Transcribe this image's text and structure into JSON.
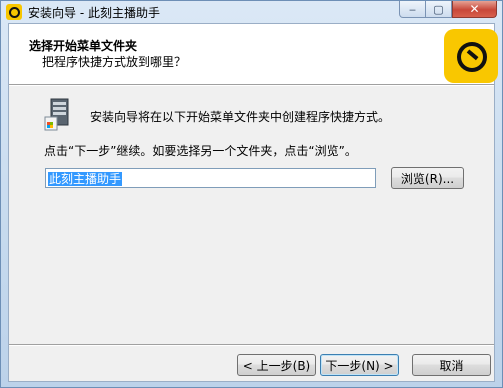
{
  "window": {
    "title": "安装向导 - 此刻主播助手",
    "minimize_glyph": "‒",
    "maximize_glyph": "▢",
    "close_glyph": "✕"
  },
  "header": {
    "title": "选择开始菜单文件夹",
    "subtitle": "把程序快捷方式放到哪里？",
    "logo_icon": "clock-logo-icon",
    "logo_color": "#f9c700"
  },
  "body": {
    "folder_icon": "start-menu-folder-icon",
    "description": "安装向导将在以下开始菜单文件夹中创建程序快捷方式。",
    "instruction": "点击“下一步”继续。如要选择另一个文件夹，点击“浏览”。",
    "folder_value": "此刻主播助手",
    "browse_label": "浏览(R)..."
  },
  "footer": {
    "back_label": "< 上一步(B)",
    "next_label": "下一步(N) >",
    "cancel_label": "取消"
  }
}
